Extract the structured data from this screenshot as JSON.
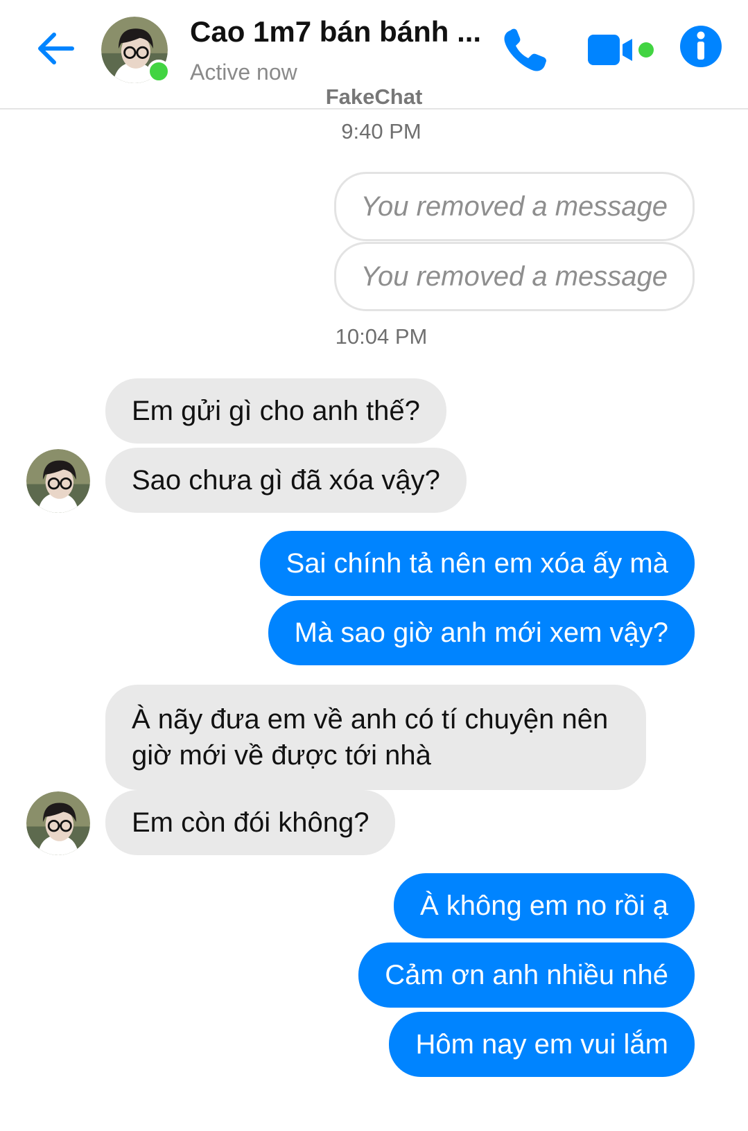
{
  "header": {
    "contact_name": "Cao 1m7 bán bánh ...",
    "status": "Active now",
    "watermark": "FakeChat",
    "colors": {
      "accent": "#0084ff",
      "online": "#42d442"
    }
  },
  "icons": {
    "back": "arrow-left",
    "call": "phone",
    "video": "video-camera",
    "info": "info-circle"
  },
  "timestamps": [
    "9:40 PM",
    "10:04 PM"
  ],
  "messages": {
    "removed_1": "You removed a message",
    "removed_2": "You removed a message",
    "in_1": "Em gửi gì cho anh thế?",
    "in_2": "Sao chưa gì đã xóa vậy?",
    "out_1": "Sai chính tả nên em xóa ấy mà",
    "out_2": "Mà sao giờ anh mới xem vậy?",
    "in_3": "À nãy đưa em về anh có tí chuyện nên giờ mới về được tới nhà",
    "in_4": "Em còn đói không?",
    "out_3": "À không em no rồi ạ",
    "out_4": "Cảm ơn anh nhiều nhé",
    "out_5": "Hôm nay em vui lắm"
  }
}
